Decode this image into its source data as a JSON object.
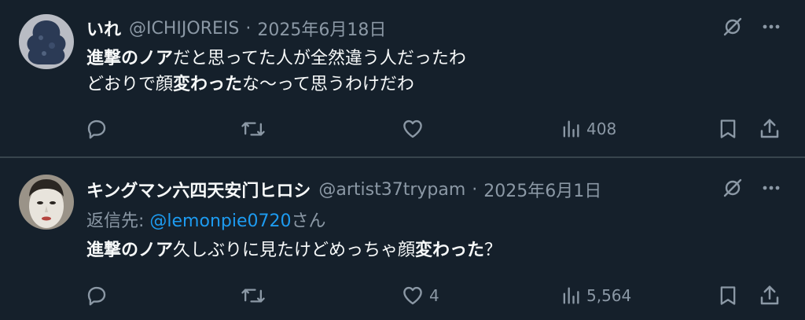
{
  "tweets": [
    {
      "name": "いれ",
      "handle": "@ICHIJOREIS",
      "separator": "·",
      "date": "2025年6月18日",
      "reply_label": "",
      "reply_mention": "",
      "reply_suffix": "",
      "lines": [
        [
          {
            "t": "進撃のノア",
            "b": true
          },
          {
            "t": "だと思ってた人が全然違う人だったわ",
            "b": false
          }
        ],
        [
          {
            "t": "どおりで顔",
            "b": false
          },
          {
            "t": "変わった",
            "b": true
          },
          {
            "t": "な〜って思うわけだわ",
            "b": false
          }
        ]
      ],
      "counts": {
        "reply": "",
        "retweet": "",
        "like": "",
        "views": "408"
      }
    },
    {
      "name": "キングマン六四天安门ヒロシ",
      "handle": "@artist37trypam",
      "separator": "·",
      "date": "2025年6月1日",
      "reply_label": "返信先: ",
      "reply_mention": "@lemonpie0720",
      "reply_suffix": "さん",
      "lines": [
        [
          {
            "t": "進撃のノア",
            "b": true
          },
          {
            "t": "久しぶりに見たけどめっちゃ顔",
            "b": false
          },
          {
            "t": "変わった",
            "b": true
          },
          {
            "t": "？",
            "b": false
          }
        ]
      ],
      "counts": {
        "reply": "",
        "retweet": "",
        "like": "4",
        "views": "5,564"
      }
    }
  ],
  "icons": {
    "more": "more-horizontal-icon",
    "grok": "grok-slash-icon",
    "reply": "reply-bubble-icon",
    "retweet": "retweet-icon",
    "like": "heart-icon",
    "views": "views-bars-icon",
    "bookmark": "bookmark-icon",
    "share": "share-upload-icon"
  },
  "colors": {
    "background": "#15202b",
    "text": "#f7f9f9",
    "secondary": "#8b98a5",
    "link": "#1d9bf0",
    "divider": "#38444d"
  }
}
